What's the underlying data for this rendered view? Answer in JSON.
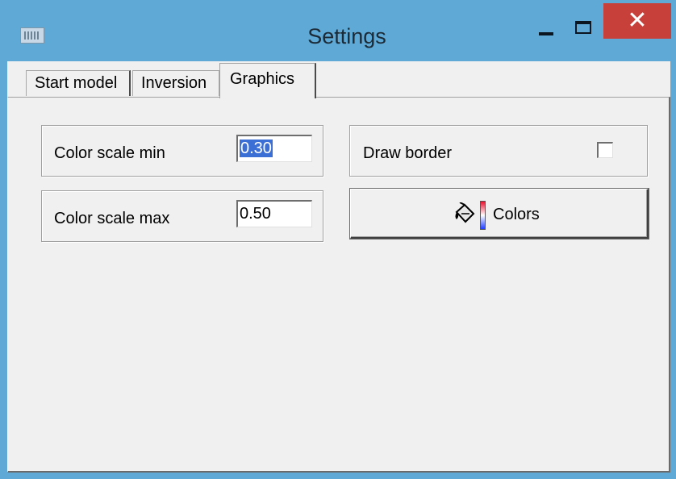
{
  "window": {
    "title": "Settings",
    "icon": "window-app-icon",
    "controls": {
      "minimize": "minimize-icon",
      "maximize": "maximize-icon",
      "close": "close-icon",
      "close_glyph": "✕"
    },
    "colors": {
      "frame": "#5ea9d6",
      "close": "#c7403a",
      "face": "#f0f0f0"
    }
  },
  "tabs": [
    {
      "label": "Start model",
      "selected": false
    },
    {
      "label": "Inversion",
      "selected": false
    },
    {
      "label": "Graphics",
      "selected": true
    }
  ],
  "graphics": {
    "color_scale_min": {
      "label": "Color scale min",
      "value": "0.30",
      "value_selected": true
    },
    "color_scale_max": {
      "label": "Color scale max",
      "value": "0.50"
    },
    "draw_border": {
      "label": "Draw border",
      "checked": false
    },
    "colors_button": {
      "label": "Colors",
      "icon": "paint-bucket-icon",
      "gradient_icon": "color-gradient-icon"
    }
  }
}
